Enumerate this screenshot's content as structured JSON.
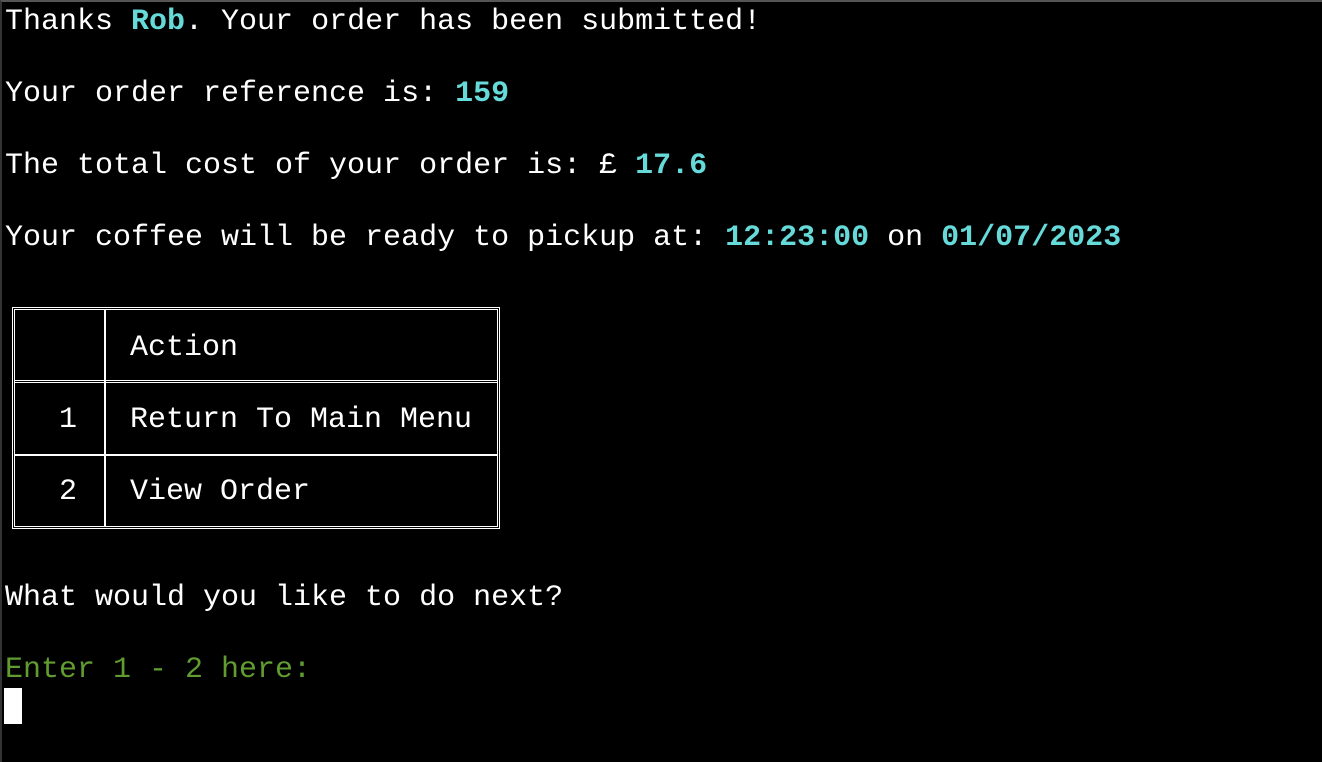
{
  "messages": {
    "thanks_prefix": "Thanks ",
    "customer_name": "Rob",
    "thanks_suffix": ". Your order has been submitted!",
    "reference_label": "Your order reference is: ",
    "reference_value": "159",
    "total_label": "The total cost of your order is: £ ",
    "total_value": "17.6",
    "pickup_label": "Your coffee will be ready to pickup at: ",
    "pickup_time": "12:23:00",
    "pickup_on": " on ",
    "pickup_date": "01/07/2023"
  },
  "table": {
    "header": [
      "",
      "Action"
    ],
    "rows": [
      {
        "num": "1",
        "action": "Return To Main Menu"
      },
      {
        "num": "2",
        "action": "View Order"
      }
    ]
  },
  "question": "What would you like to do next?",
  "input_prompt": "Enter 1 - 2 here:",
  "colors": {
    "highlight": "#66d9d9",
    "prompt": "#609c30",
    "background": "#000000",
    "text": "#ffffff"
  }
}
